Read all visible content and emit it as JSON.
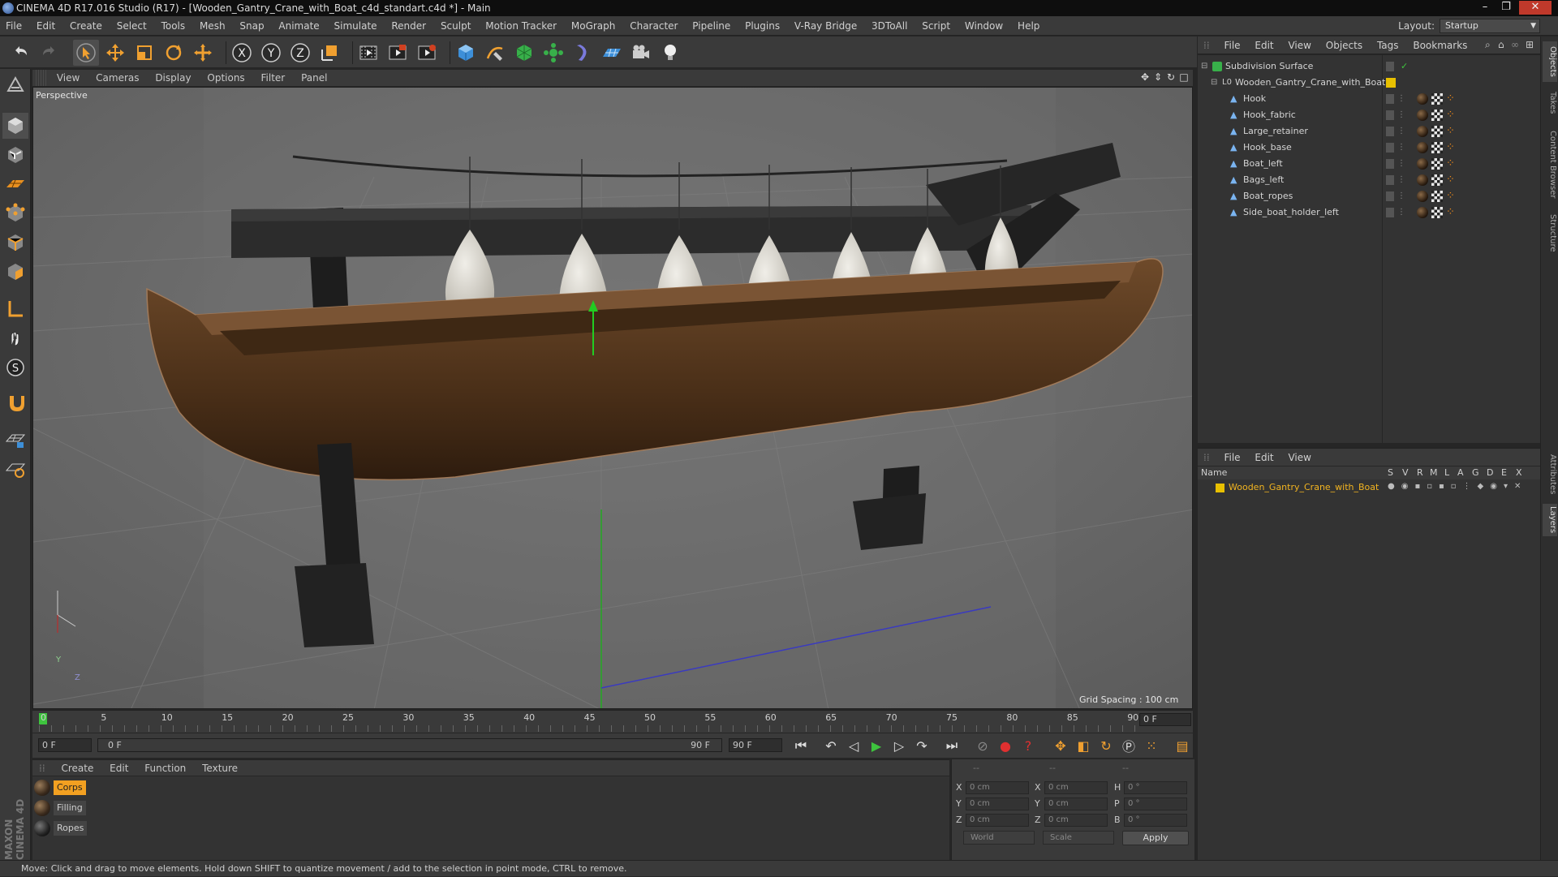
{
  "window": {
    "title": "CINEMA 4D R17.016 Studio (R17) - [Wooden_Gantry_Crane_with_Boat_c4d_standart.c4d *] - Main",
    "controls": [
      "–",
      "❐",
      "✕"
    ]
  },
  "menubar": {
    "items": [
      "File",
      "Edit",
      "Create",
      "Select",
      "Tools",
      "Mesh",
      "Snap",
      "Animate",
      "Simulate",
      "Render",
      "Sculpt",
      "Motion Tracker",
      "MoGraph",
      "Character",
      "Pipeline",
      "Plugins",
      "V-Ray Bridge",
      "3DToAll",
      "Script",
      "Window",
      "Help"
    ],
    "layout_label": "Layout:",
    "layout_value": "Startup"
  },
  "toolbar": {
    "icons": [
      "undo-icon",
      "redo-icon",
      "select-arrow-icon",
      "move-icon",
      "scale-icon",
      "rotate-icon",
      "live-selection-icon",
      "x-axis-icon",
      "y-axis-icon",
      "z-axis-icon",
      "world-coords-icon",
      "render-view-icon",
      "render-picture-viewer-icon",
      "edit-render-settings-icon",
      "cube-icon",
      "spline-pen-icon",
      "subdivision-icon",
      "array-icon",
      "deformer-icon",
      "floor-icon",
      "camera-icon",
      "light-icon"
    ],
    "axis_labels": [
      "X",
      "Y",
      "Z"
    ]
  },
  "viewport": {
    "menus": [
      "View",
      "Cameras",
      "Display",
      "Options",
      "Filter",
      "Panel"
    ],
    "camera_label": "Perspective",
    "grid_spacing": "Grid Spacing : 100 cm",
    "axis_labels": [
      "Y",
      "Z"
    ]
  },
  "timeline": {
    "ticks": [
      "0",
      "5",
      "10",
      "15",
      "20",
      "25",
      "30",
      "35",
      "40",
      "45",
      "50",
      "55",
      "60",
      "65",
      "70",
      "75",
      "80",
      "85",
      "90"
    ],
    "current_frame": "0 F",
    "start_frame": "0 F",
    "range_start": "0 F",
    "range_end": "90 F",
    "end_frame": "90 F"
  },
  "materials": {
    "menus": [
      "Create",
      "Edit",
      "Function",
      "Texture"
    ],
    "items": [
      {
        "name": "Corps",
        "selected": true
      },
      {
        "name": "Filling",
        "selected": false
      },
      {
        "name": "Ropes",
        "selected": false
      }
    ]
  },
  "coordinates": {
    "headers": [
      "--",
      "--",
      "--"
    ],
    "pos_labels": [
      "X",
      "Y",
      "Z"
    ],
    "size_labels": [
      "X",
      "Y",
      "Z"
    ],
    "rot_labels": [
      "H",
      "P",
      "B"
    ],
    "pos_values": [
      "0 cm",
      "0 cm",
      "0 cm"
    ],
    "size_values": [
      "0 cm",
      "0 cm",
      "0 cm"
    ],
    "rot_values": [
      "0 °",
      "0 °",
      "0 °"
    ],
    "mode_world": "World",
    "mode_scale": "Scale",
    "apply_label": "Apply"
  },
  "object_manager": {
    "menus": [
      "File",
      "Edit",
      "View",
      "Objects",
      "Tags",
      "Bookmarks"
    ],
    "objects": [
      {
        "name": "Subdivision Surface",
        "depth": 0
      },
      {
        "name": "Wooden_Gantry_Crane_with_Boat",
        "depth": 1
      },
      {
        "name": "Hook",
        "depth": 2
      },
      {
        "name": "Hook_fabric",
        "depth": 2
      },
      {
        "name": "Large_retainer",
        "depth": 2
      },
      {
        "name": "Hook_base",
        "depth": 2
      },
      {
        "name": "Boat_left",
        "depth": 2
      },
      {
        "name": "Bags_left",
        "depth": 2
      },
      {
        "name": "Boat_ropes",
        "depth": 2
      },
      {
        "name": "Side_boat_holder_left",
        "depth": 2
      }
    ]
  },
  "layer_manager": {
    "menus": [
      "File",
      "Edit",
      "View"
    ],
    "column_name": "Name",
    "columns": [
      "S",
      "V",
      "R",
      "M",
      "L",
      "A",
      "G",
      "D",
      "E",
      "X"
    ],
    "layers": [
      {
        "name": "Wooden_Gantry_Crane_with_Boat",
        "color": "#e8c000"
      }
    ]
  },
  "side_tabs": [
    "Objects",
    "Takes",
    "Content Browser",
    "Structure",
    "Attributes",
    "Layers"
  ],
  "branding": "MAXON CINEMA 4D",
  "status": "Move: Click and drag to move elements. Hold down SHIFT to quantize movement / add to the selection in point mode, CTRL to remove.",
  "colors": {
    "accent": "#f2a021",
    "layer_color": "#e8c000",
    "boat": "#5a3a20"
  }
}
